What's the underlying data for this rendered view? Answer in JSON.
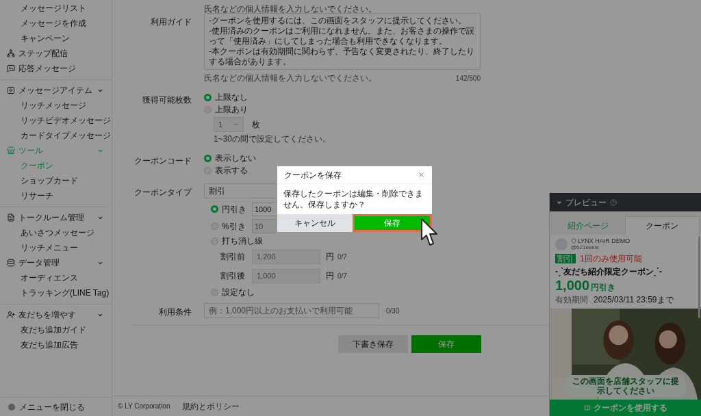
{
  "sidebar": {
    "sections": [
      {
        "children": [
          {
            "label": "メッセージリスト",
            "selected": false
          },
          {
            "label": "メッセージを作成",
            "selected": false
          },
          {
            "label": "キャンペーン",
            "selected": false
          }
        ],
        "items": [
          {
            "label": "ステップ配信",
            "active": false
          },
          {
            "label": "応答メッセージ",
            "active": false
          }
        ]
      },
      {
        "items": [
          {
            "label": "メッセージアイテム",
            "active": false,
            "expanded": true,
            "children": [
              {
                "label": "リッチメッセージ",
                "selected": false
              },
              {
                "label": "リッチビデオメッセージ",
                "selected": false
              },
              {
                "label": "カードタイプメッセージ",
                "selected": false
              }
            ]
          },
          {
            "label": "ツール",
            "active": true,
            "expanded": true,
            "children": [
              {
                "label": "クーポン",
                "selected": true
              },
              {
                "label": "ショップカード",
                "selected": false
              },
              {
                "label": "リサーチ",
                "selected": false
              }
            ]
          }
        ]
      },
      {
        "items": [
          {
            "label": "トークルーム管理",
            "active": false,
            "expanded": true,
            "children": [
              {
                "label": "あいさつメッセージ",
                "selected": false
              },
              {
                "label": "リッチメニュー",
                "selected": false
              }
            ]
          },
          {
            "label": "データ管理",
            "active": false,
            "expanded": true,
            "children": [
              {
                "label": "オーディエンス",
                "selected": false
              },
              {
                "label": "トラッキング(LINE Tag)",
                "selected": false
              }
            ]
          }
        ]
      },
      {
        "items": [
          {
            "label": "友だちを増やす",
            "active": false,
            "expanded": true,
            "children": [
              {
                "label": "友だち追加ガイド",
                "selected": false
              },
              {
                "label": "友だち追加広告",
                "selected": false
              }
            ]
          }
        ]
      }
    ],
    "close_menu": "メニューを閉じる"
  },
  "form": {
    "top_note": "氏名などの個人情報を入力しないでください。",
    "guide": {
      "label": "利用ガイド",
      "value": "-クーポンを使用するには、この画面をスタッフに提示してください。\n-使用済みのクーポンはご利用になれません。また、お客さまの操作で誤って「使用済み」にしてしまった場合も利用できなくなります。\n-本クーポンは有効期間に関わらず、予告なく変更されたり、終了したりする場合があります。",
      "hint": "氏名などの個人情報を入力しないでください。",
      "count": "142/500"
    },
    "limit": {
      "label": "獲得可能枚数",
      "options": [
        {
          "label": "上限なし",
          "selected": true
        },
        {
          "label": "上限あり",
          "selected": false
        }
      ],
      "select_value": "1",
      "unit": "枚",
      "hint": "1~30の間で設定してください。"
    },
    "code": {
      "label": "クーポンコード",
      "options": [
        {
          "label": "表示しない",
          "selected": true
        },
        {
          "label": "表示する",
          "selected": false
        }
      ]
    },
    "type": {
      "label": "クーポンタイプ",
      "select_value": "割引",
      "options": [
        {
          "kind": "input",
          "label": "円引き",
          "selected": true,
          "value": "1000"
        },
        {
          "kind": "input",
          "label": "%引き",
          "selected": false,
          "placeholder": "10"
        },
        {
          "kind": "strike",
          "label": "打ち消し線",
          "selected": false,
          "fields": [
            {
              "label": "割引前",
              "placeholder": "1,200",
              "unit": "円",
              "count": "0/7"
            },
            {
              "label": "割引後",
              "placeholder": "1,000",
              "unit": "円",
              "count": "0/7"
            }
          ]
        },
        {
          "kind": "plain",
          "label": "設定なし",
          "selected": false
        }
      ]
    },
    "conditions": {
      "label": "利用条件",
      "placeholder": "例：1,000円以上のお支払いで利用可能",
      "count": "0/30"
    },
    "buttons": {
      "draft": "下書き保存",
      "save": "保存"
    }
  },
  "footer": {
    "copyright": "© LY Corporation",
    "link": "規約とポリシー"
  },
  "dialog": {
    "title": "クーポンを保存",
    "message": "保存したクーポンは編集・削除できません。保存しますか？",
    "cancel": "キャンセル",
    "confirm": "保存",
    "confirm_highlighted": true
  },
  "preview": {
    "title": "プレビュー",
    "tabs": [
      {
        "label": "紹介ページ",
        "selected": false
      },
      {
        "label": "クーポン",
        "selected": true
      }
    ],
    "account": "LYNX HAIR DEMO",
    "handle": "@621eeele",
    "badge": "割引",
    "usage": "1回のみ使用可能",
    "coupon_title": "-ˏˋ友だち紹介限定クーポンˎˊ-",
    "amount": "1,000",
    "amount_unit": "円引き",
    "validity_label": "有効期間",
    "validity": "2025/03/11 23:59まで",
    "notice": "この画面を店舗スタッフに提示してください",
    "use_button": "クーポンを使用する"
  }
}
